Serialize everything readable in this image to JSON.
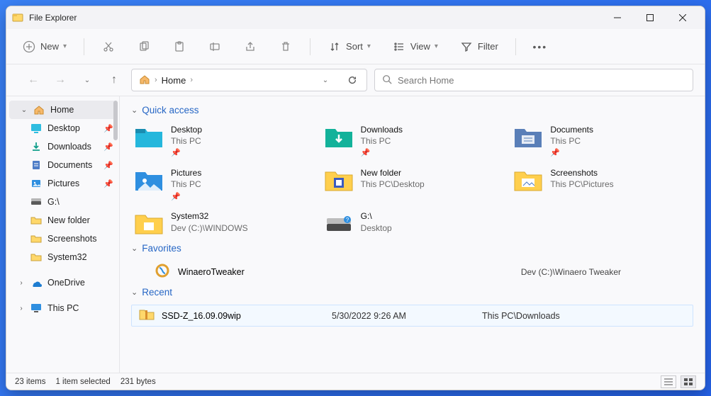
{
  "window": {
    "title": "File Explorer"
  },
  "toolbar": {
    "new": "New",
    "sort": "Sort",
    "view": "View",
    "filter": "Filter"
  },
  "breadcrumb": {
    "home": "Home"
  },
  "search": {
    "placeholder": "Search Home"
  },
  "sidebar": {
    "home": "Home",
    "items": [
      {
        "label": "Desktop",
        "pinned": true
      },
      {
        "label": "Downloads",
        "pinned": true
      },
      {
        "label": "Documents",
        "pinned": true
      },
      {
        "label": "Pictures",
        "pinned": true
      },
      {
        "label": "G:\\",
        "pinned": false
      },
      {
        "label": "New folder",
        "pinned": false
      },
      {
        "label": "Screenshots",
        "pinned": false
      },
      {
        "label": "System32",
        "pinned": false
      }
    ],
    "onedrive": "OneDrive",
    "this_pc": "This PC"
  },
  "sections": {
    "quick_access": "Quick access",
    "favorites": "Favorites",
    "recent": "Recent"
  },
  "quick_access": [
    {
      "name": "Desktop",
      "sub": "This PC",
      "pinned": true,
      "icon": "desktop"
    },
    {
      "name": "Downloads",
      "sub": "This PC",
      "pinned": true,
      "icon": "downloads"
    },
    {
      "name": "Documents",
      "sub": "This PC",
      "pinned": true,
      "icon": "documents"
    },
    {
      "name": "Pictures",
      "sub": "This PC",
      "pinned": true,
      "icon": "pictures"
    },
    {
      "name": "New folder",
      "sub": "This PC\\Desktop",
      "pinned": false,
      "icon": "folder"
    },
    {
      "name": "Screenshots",
      "sub": "This PC\\Pictures",
      "pinned": false,
      "icon": "folder"
    },
    {
      "name": "System32",
      "sub": "Dev (C:)\\WINDOWS",
      "pinned": false,
      "icon": "folder"
    },
    {
      "name": "G:\\",
      "sub": "Desktop",
      "pinned": false,
      "icon": "drive"
    }
  ],
  "favorites": [
    {
      "name": "WinaeroTweaker",
      "path": "Dev (C:)\\Winaero Tweaker"
    }
  ],
  "recent": [
    {
      "name": "SSD-Z_16.09.09wip",
      "date": "5/30/2022 9:26 AM",
      "path": "This PC\\Downloads"
    }
  ],
  "statusbar": {
    "count": "23 items",
    "selection": "1 item selected",
    "size": "231 bytes"
  }
}
